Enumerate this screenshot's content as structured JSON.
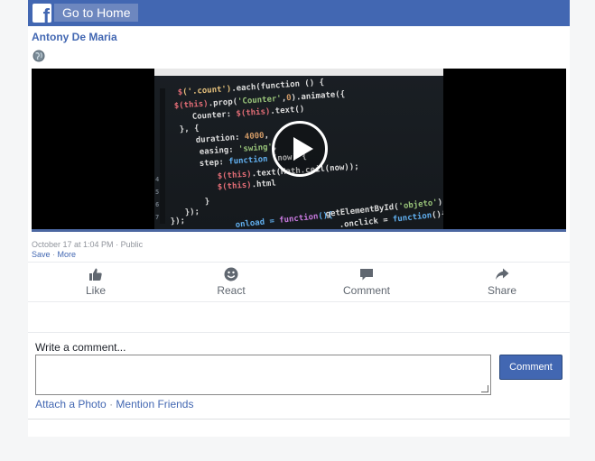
{
  "topbar": {
    "home_label": "Go to Home"
  },
  "post": {
    "author": "Antony De Maria",
    "timestamp": "October 17 at 1:04 PM",
    "privacy": "Public",
    "save_label": "Save",
    "more_label": "More"
  },
  "actions": [
    {
      "label": "Like",
      "icon": "thumbs-up-icon"
    },
    {
      "label": "React",
      "icon": "smiley-icon"
    },
    {
      "label": "Comment",
      "icon": "speech-bubble-icon"
    },
    {
      "label": "Share",
      "icon": "share-arrow-icon"
    }
  ],
  "comment": {
    "prompt": "Write a comment...",
    "button_label": "Comment",
    "attach_label": "Attach a Photo",
    "mention_label": "Mention Friends"
  },
  "colors": {
    "brand": "#4267b2",
    "muted": "#90949c",
    "icon": "#606770"
  }
}
